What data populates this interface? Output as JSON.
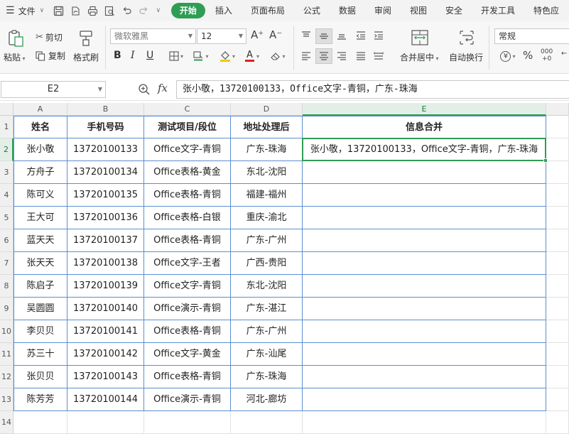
{
  "menubar": {
    "file_label": "文件",
    "tabs": [
      {
        "label": "开始",
        "active": true
      },
      {
        "label": "插入",
        "active": false
      },
      {
        "label": "页面布局",
        "active": false
      },
      {
        "label": "公式",
        "active": false
      },
      {
        "label": "数据",
        "active": false
      },
      {
        "label": "审阅",
        "active": false
      },
      {
        "label": "视图",
        "active": false
      },
      {
        "label": "安全",
        "active": false
      },
      {
        "label": "开发工具",
        "active": false
      },
      {
        "label": "特色应",
        "active": false
      }
    ]
  },
  "ribbon": {
    "paste_label": "粘贴",
    "cut_label": "剪切",
    "copy_label": "复制",
    "format_painter_label": "格式刷",
    "font_name": "微软雅黑",
    "font_size": "12",
    "merge_label": "合并居中",
    "wrap_label": "自动换行",
    "number_format": "常规",
    "grow_font": "A⁺",
    "shrink_font": "A⁻"
  },
  "formula_bar": {
    "name_box": "E2",
    "fx_label": "fx",
    "content": "张小敬，13720100133，Office文字-青铜，广东-珠海"
  },
  "sheet": {
    "columns": [
      "A",
      "B",
      "C",
      "D",
      "E"
    ],
    "selected_column": "E",
    "selected_row": 2,
    "row_numbers": [
      1,
      2,
      3,
      4,
      5,
      6,
      7,
      8,
      9,
      10,
      11,
      12,
      13,
      14
    ],
    "headers": [
      "姓名",
      "手机号码",
      "测试项目/段位",
      "地址处理后",
      "信息合并"
    ],
    "rows": [
      [
        "张小敬",
        "13720100133",
        "Office文字-青铜",
        "广东-珠海",
        "张小敬，13720100133，Office文字-青铜，广东-珠海"
      ],
      [
        "方舟子",
        "13720100134",
        "Office表格-黄金",
        "东北-沈阳",
        ""
      ],
      [
        "陈可义",
        "13720100135",
        "Office表格-青铜",
        "福建-福州",
        ""
      ],
      [
        "王大可",
        "13720100136",
        "Office表格-白银",
        "重庆-渝北",
        ""
      ],
      [
        "蓝天天",
        "13720100137",
        "Office表格-青铜",
        "广东-广州",
        ""
      ],
      [
        "张天天",
        "13720100138",
        "Office文字-王者",
        "广西-贵阳",
        ""
      ],
      [
        "陈启子",
        "13720100139",
        "Office文字-青铜",
        "东北-沈阳",
        ""
      ],
      [
        "吴圆圆",
        "13720100140",
        "Office演示-青铜",
        "广东-湛江",
        ""
      ],
      [
        "李贝贝",
        "13720100141",
        "Office表格-青铜",
        "广东-广州",
        ""
      ],
      [
        "苏三十",
        "13720100142",
        "Office文字-黄金",
        "广东-汕尾",
        ""
      ],
      [
        "张贝贝",
        "13720100143",
        "Office表格-青铜",
        "广东-珠海",
        ""
      ],
      [
        "陈芳芳",
        "13720100144",
        "Office演示-青铜",
        "河北-廊坊",
        ""
      ]
    ]
  },
  "colors": {
    "accent": "#2f9d55",
    "table_border": "#5b8fd0"
  }
}
